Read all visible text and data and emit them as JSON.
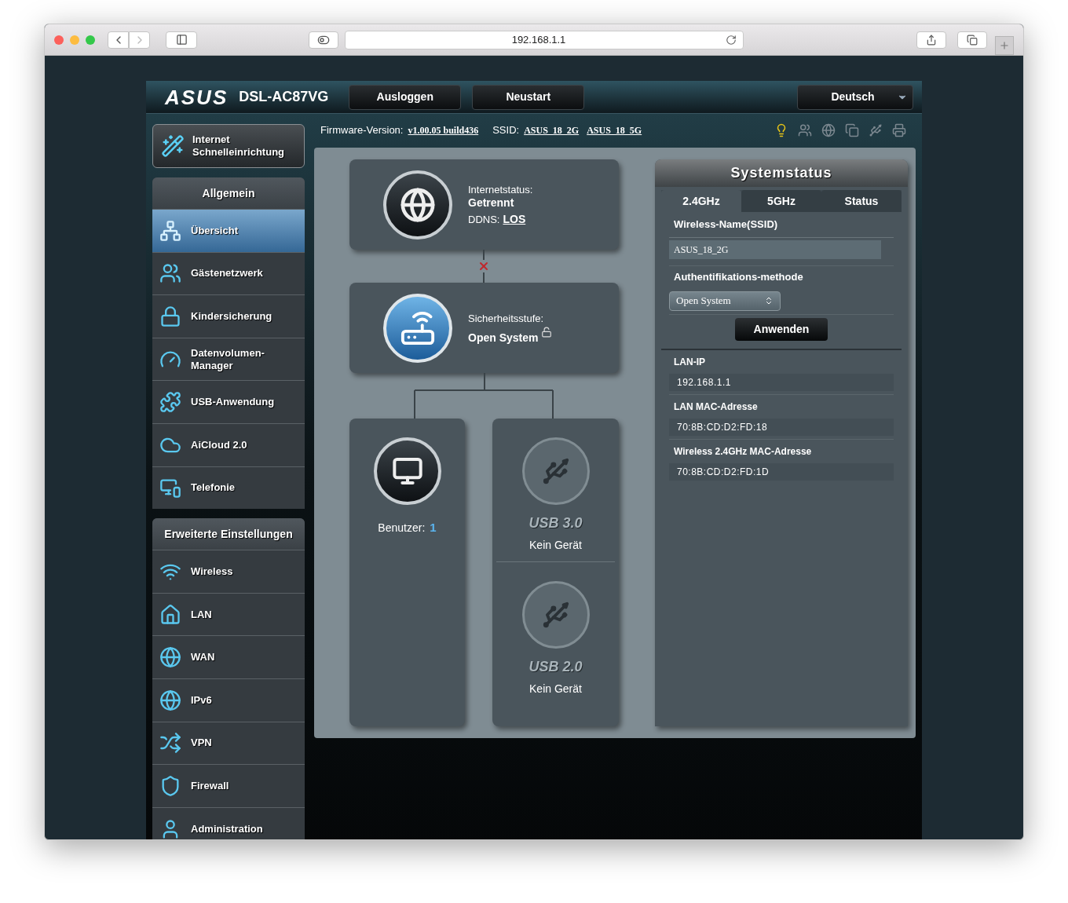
{
  "browser": {
    "url": "192.168.1.1"
  },
  "header": {
    "logo": "ASUS",
    "model": "DSL-AC87VG",
    "buttons": [
      "Ausloggen",
      "Neustart"
    ],
    "language": "Deutsch"
  },
  "info_bar": {
    "firmware_label": "Firmware-Version:",
    "firmware": "v1.00.05 build436",
    "ssid_label": "SSID:",
    "ssids": [
      "ASUS_18_2G",
      "ASUS_18_5G"
    ]
  },
  "status_icons": [
    {
      "kind": "lightbulb",
      "on": true
    },
    {
      "kind": "users",
      "on": false
    },
    {
      "kind": "globe",
      "on": false
    },
    {
      "kind": "screens",
      "on": false
    },
    {
      "kind": "usb",
      "on": false
    },
    {
      "kind": "printer",
      "on": false
    }
  ],
  "sidebar": {
    "quick_setup": "Internet Schnelleinrichtung",
    "groups": [
      {
        "title": "Allgemein",
        "items": [
          {
            "label": "Übersicht",
            "kind": "network",
            "selected": true
          },
          {
            "label": "Gästenetzwerk",
            "kind": "users",
            "selected": false
          },
          {
            "label": "Kindersicherung",
            "kind": "lock",
            "selected": false
          },
          {
            "label": "Datenvolumen-Manager",
            "kind": "gauge",
            "selected": false
          },
          {
            "label": "USB-Anwendung",
            "kind": "puzzle",
            "selected": false
          },
          {
            "label": "AiCloud 2.0",
            "kind": "cloud",
            "selected": false
          },
          {
            "label": "Telefonie",
            "kind": "phone",
            "selected": false
          }
        ]
      },
      {
        "title": "Erweiterte Einstellungen",
        "items": [
          {
            "label": "Wireless",
            "kind": "wifi",
            "selected": false
          },
          {
            "label": "LAN",
            "kind": "home",
            "selected": false
          },
          {
            "label": "WAN",
            "kind": "globe",
            "selected": false
          },
          {
            "label": "IPv6",
            "kind": "globe",
            "selected": false
          },
          {
            "label": "VPN",
            "kind": "vpn",
            "selected": false
          },
          {
            "label": "Firewall",
            "kind": "shield",
            "selected": false
          },
          {
            "label": "Administration",
            "kind": "user",
            "selected": false
          }
        ]
      }
    ]
  },
  "diagram": {
    "internet": {
      "label": "Internetstatus:",
      "value": "Getrennt",
      "ddns_label": "DDNS:",
      "ddns": "LOS",
      "connected": false
    },
    "router": {
      "label": "Sicherheitsstufe:",
      "value": "Open System",
      "locked": false
    },
    "clients": {
      "label": "Benutzer:",
      "count": "1"
    },
    "usb_ports": [
      {
        "label": "USB 3.0",
        "status": "Kein Gerät"
      },
      {
        "label": "USB 2.0",
        "status": "Kein Gerät"
      }
    ]
  },
  "system_status": {
    "title": "Systemstatus",
    "tabs": [
      {
        "label": "2.4GHz",
        "selected": true
      },
      {
        "label": "5GHz",
        "selected": false
      },
      {
        "label": "Status",
        "selected": false
      }
    ],
    "ssid_label": "Wireless-Name(SSID)",
    "ssid": "ASUS_18_2G",
    "auth_label": "Authentifikations-methode",
    "auth": "Open System",
    "apply": "Anwenden",
    "info": [
      {
        "label": "LAN-IP",
        "value": "192.168.1.1"
      },
      {
        "label": "LAN MAC-Adresse",
        "value": "70:8B:CD:D2:FD:18"
      },
      {
        "label": "Wireless 2.4GHz MAC-Adresse",
        "value": "70:8B:CD:D2:FD:1D"
      }
    ]
  }
}
